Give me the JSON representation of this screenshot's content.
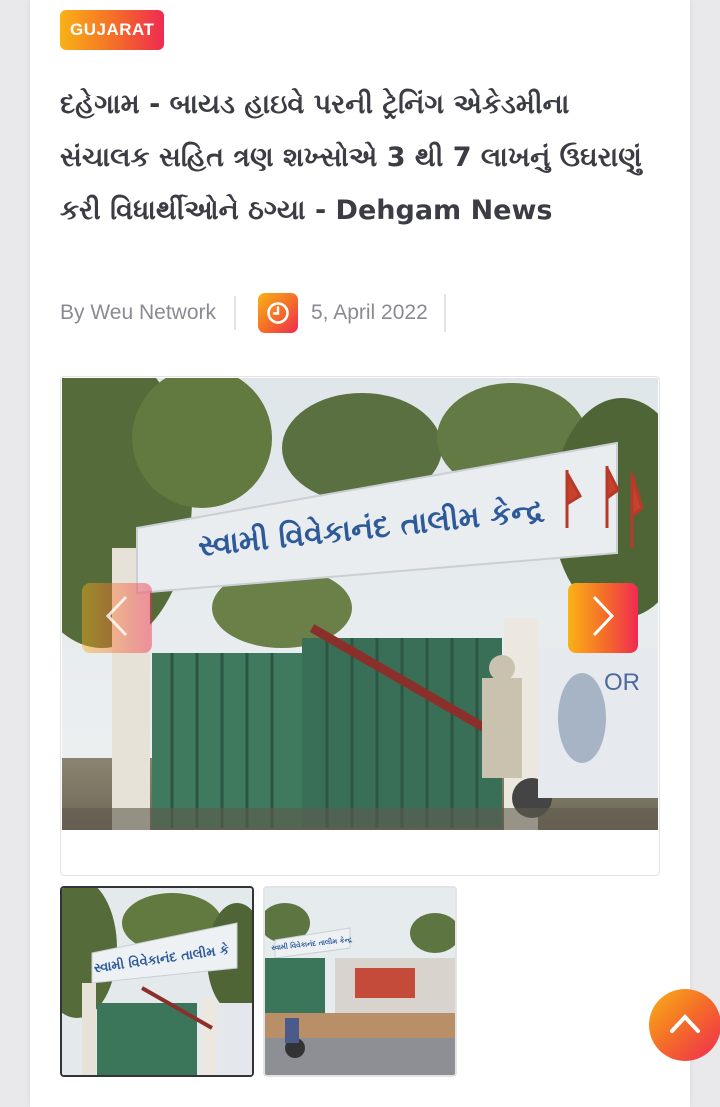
{
  "article": {
    "category": "GUJARAT",
    "title": "દહેગામ - બાયડ હાઇવે પરની ટ્રેનિંગ એકેડમીના સંચાલક સહિત ત્રણ શખ્સોએ 3 થી 7 લાખનું ઉઘરાણું કરી વિધાર્થીઓને ઠગ્યા - Dehgam News",
    "author": "By Weu Network",
    "date": "5, April 2022"
  },
  "gallery": {
    "main_sign_text": "સ્વામી વિવેકાનંદ તાલીમ કેન્દ્ર",
    "wall_text": "OR",
    "thumb1_sign_text": "સ્વામી વિવેકાનંદ તાલીમ કે",
    "thumb2_sign_text": "સ્વામી વિવેકાનંદ તાલીમ કેન્દ્ર"
  },
  "colors": {
    "accent_start": "#f9b216",
    "accent_mid": "#f46a2a",
    "accent_end": "#f02a52",
    "title_text": "#3c3c44",
    "meta_text": "#8a8a92"
  },
  "icons": {
    "date": "clock-icon",
    "prev": "chevron-left-icon",
    "next": "chevron-right-icon",
    "scroll_top": "chevron-up-icon"
  }
}
